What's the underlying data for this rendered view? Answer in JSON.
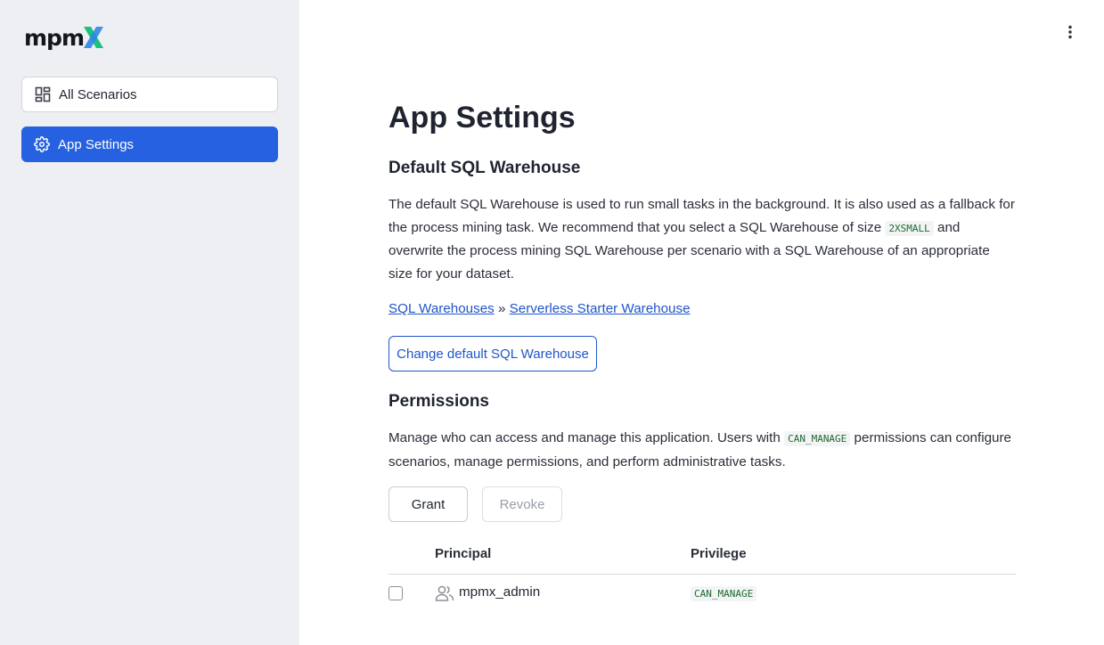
{
  "app": {
    "logo_text": "mpm"
  },
  "sidebar": {
    "items": [
      {
        "label": "All Scenarios",
        "icon": "dashboard-icon",
        "active": false
      },
      {
        "label": "App Settings",
        "icon": "gear-icon",
        "active": true
      }
    ]
  },
  "colors": {
    "accent": "#2561e0",
    "link": "#1f55c9",
    "sidebar_bg": "#eeeff2",
    "logo_x_green": "#19c37d",
    "logo_x_blue": "#2e86e8"
  },
  "main": {
    "title": "App Settings",
    "sql_section": {
      "heading": "Default SQL Warehouse",
      "desc_1": "The default SQL Warehouse is used to run small tasks in the background. It is also used as a fallback for the process mining task. We recommend that you select a SQL Warehouse of size",
      "size_code": "2XSMALL",
      "desc_2": "and overwrite the process mining SQL Warehouse per scenario with a SQL Warehouse of an appropriate size for your dataset.",
      "breadcrumb_root": "SQL Warehouses",
      "breadcrumb_sep": "»",
      "breadcrumb_current": "Serverless Starter Warehouse",
      "change_button": "Change default SQL Warehouse"
    },
    "permissions": {
      "heading": "Permissions",
      "desc_1": "Manage who can access and manage this application. Users with",
      "perm_code": "CAN_MANAGE",
      "desc_2": "permissions can configure scenarios, manage permissions, and perform administrative tasks.",
      "grant_button": "Grant",
      "revoke_button": "Revoke",
      "columns": [
        "Principal",
        "Privilege"
      ],
      "rows": [
        {
          "principal": "mpmx_admin",
          "privilege": "CAN_MANAGE",
          "checked": false
        }
      ]
    }
  }
}
